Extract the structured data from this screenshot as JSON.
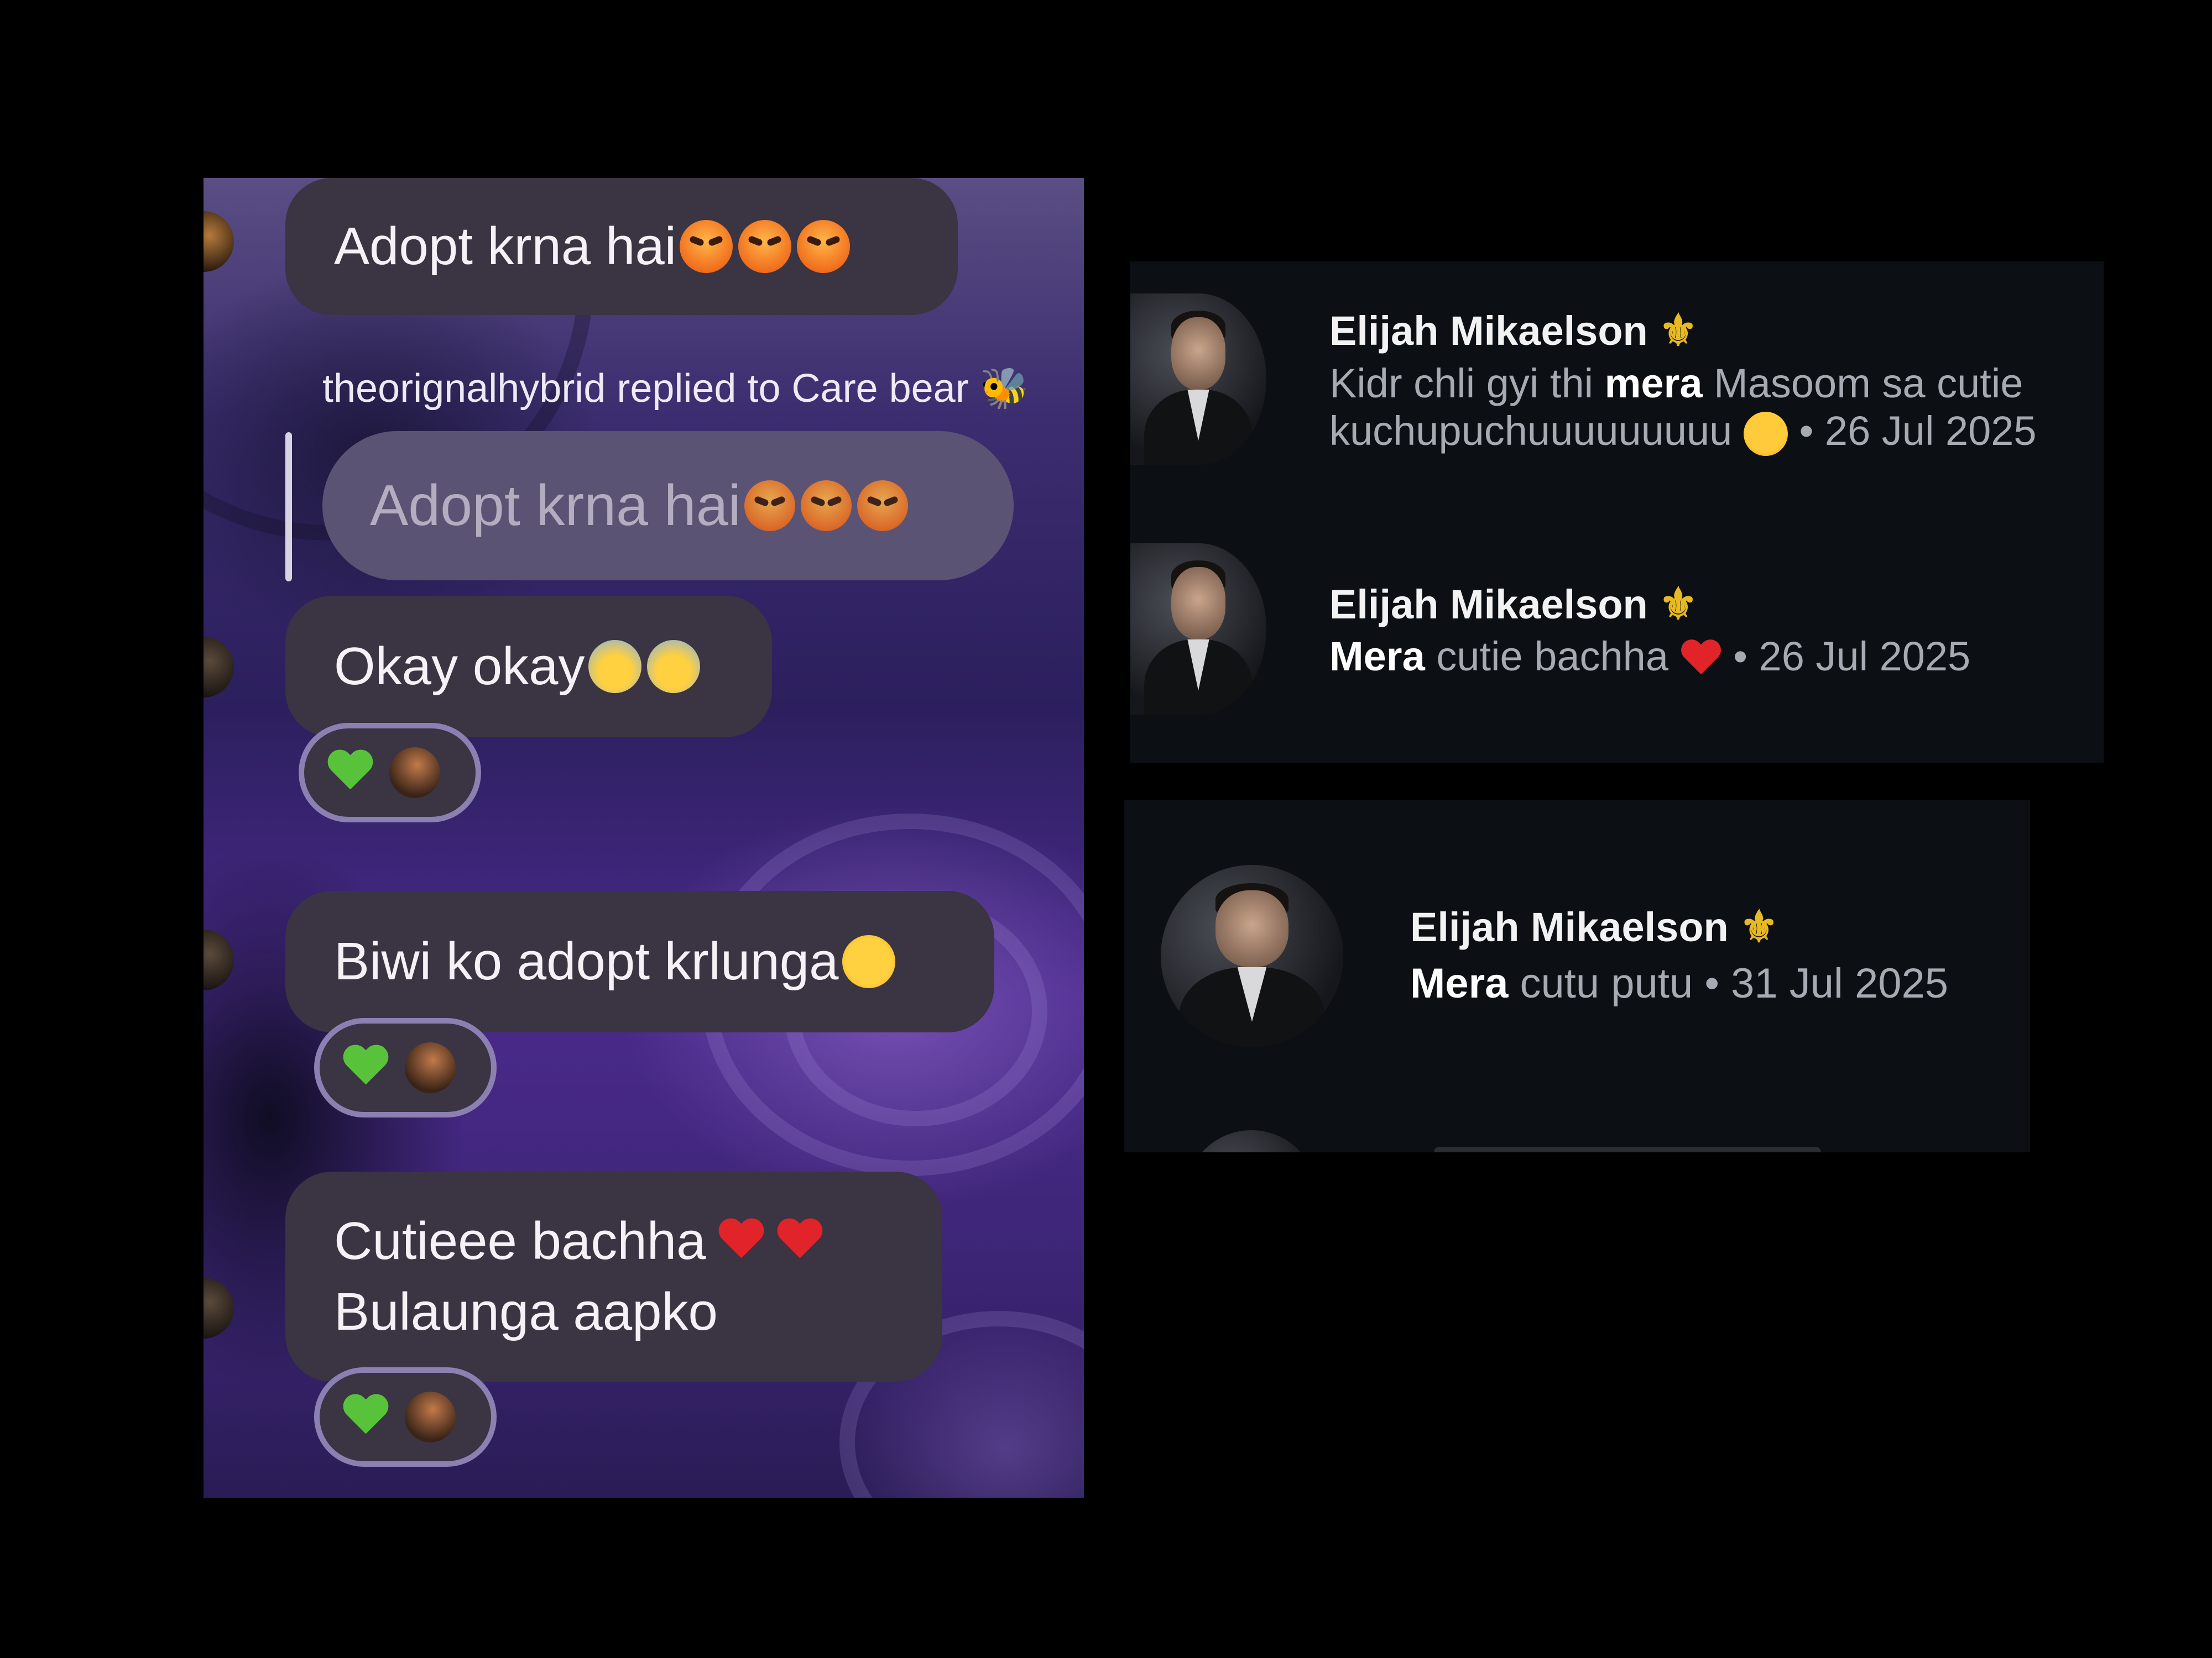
{
  "chat": {
    "messages": [
      {
        "text": "Adopt krna hai",
        "emojis": [
          "angry-face-icon",
          "angry-face-icon",
          "angry-face-icon"
        ]
      },
      {
        "text": "Okay okay",
        "emojis": [
          "anxious-face-icon",
          "anxious-face-icon"
        ],
        "reaction": "green-heart-icon"
      },
      {
        "text": "Biwi ko adopt krlunga",
        "emojis": [
          "downcast-sweat-face-icon"
        ],
        "reaction": "green-heart-icon"
      },
      {
        "line1": "Cutieee bachha",
        "line2": "Bulaunga aapko",
        "emojis": [
          "red-heart-icon",
          "red-heart-icon"
        ],
        "reaction": "green-heart-icon"
      }
    ],
    "reply": {
      "label": "theorignalhybrid replied to Care bear 🐝",
      "quoted_text": "Adopt krna hai"
    }
  },
  "notifications": [
    {
      "name": "Elijah Mikaelson",
      "pre": "Kidr chli gyi thi ",
      "bold": "mera",
      "post": " Masoom sa cutie",
      "line2": "kuchupuchuuuuuuuuu",
      "date": "• 26 Jul 2025"
    },
    {
      "name": "Elijah Mikaelson",
      "bold": "Mera",
      "post": " cutie bachha ",
      "date": "• 26 Jul 2025"
    },
    {
      "name": "Elijah Mikaelson",
      "bold": "Mera",
      "post": " cutu putu ",
      "date": "• 31 Jul 2025"
    }
  ],
  "colors": {
    "chat_bubble": "#3a3443",
    "reply_bubble": "#5b5373",
    "reaction_border": "#8c80b3",
    "panel_bg": "#0c1015",
    "muted_text": "#a6abb3",
    "fleur_gold": "#e8b923"
  },
  "symbols": {
    "fleur": "⚜"
  }
}
